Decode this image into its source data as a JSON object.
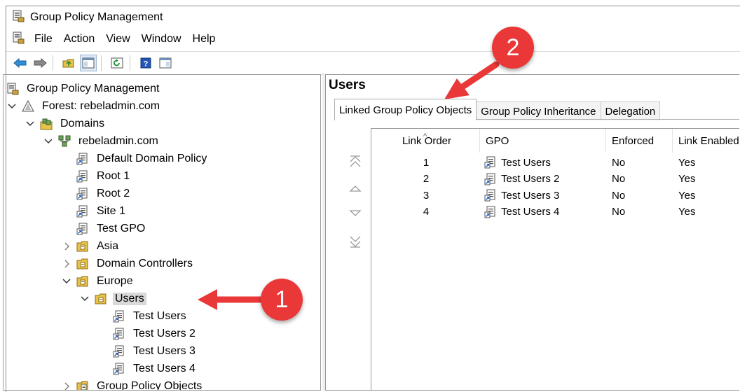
{
  "window": {
    "title": "Group Policy Management"
  },
  "menu": [
    "File",
    "Action",
    "View",
    "Window",
    "Help"
  ],
  "toolbar": {
    "buttons": [
      "back-icon",
      "forward-icon",
      "up-folder-icon",
      "show-hide-tree-icon",
      "refresh-icon",
      "help-icon",
      "properties-icon"
    ]
  },
  "tree": {
    "root": "Group Policy Management",
    "forest": "Forest: rebeladmin.com",
    "domains": "Domains",
    "domain": "rebeladmin.com",
    "gpo_links": [
      "Default Domain Policy",
      "Root 1",
      "Root 2",
      "Site 1",
      "Test GPO"
    ],
    "ous": [
      "Asia",
      "Domain Controllers",
      "Europe"
    ],
    "selected_ou": "Users",
    "user_links": [
      "Test Users",
      "Test Users 2",
      "Test Users 3",
      "Test Users 4"
    ],
    "gpo_container": "Group Policy Objects"
  },
  "details": {
    "title": "Users",
    "tabs": [
      "Linked Group Policy Objects",
      "Group Policy Inheritance",
      "Delegation"
    ],
    "active_tab": 0,
    "columns": [
      "Link Order",
      "GPO",
      "Enforced",
      "Link Enabled"
    ],
    "rows": [
      {
        "order": "1",
        "gpo": "Test Users",
        "enforced": "No",
        "enabled": "Yes"
      },
      {
        "order": "2",
        "gpo": "Test Users 2",
        "enforced": "No",
        "enabled": "Yes"
      },
      {
        "order": "3",
        "gpo": "Test Users 3",
        "enforced": "No",
        "enabled": "Yes"
      },
      {
        "order": "4",
        "gpo": "Test Users 4",
        "enforced": "No",
        "enabled": "Yes"
      }
    ]
  },
  "callouts": [
    "1",
    "2"
  ],
  "colors": {
    "callout": "#ea3838",
    "folder": "#e8c24a",
    "selection": "#d9d9d9"
  }
}
